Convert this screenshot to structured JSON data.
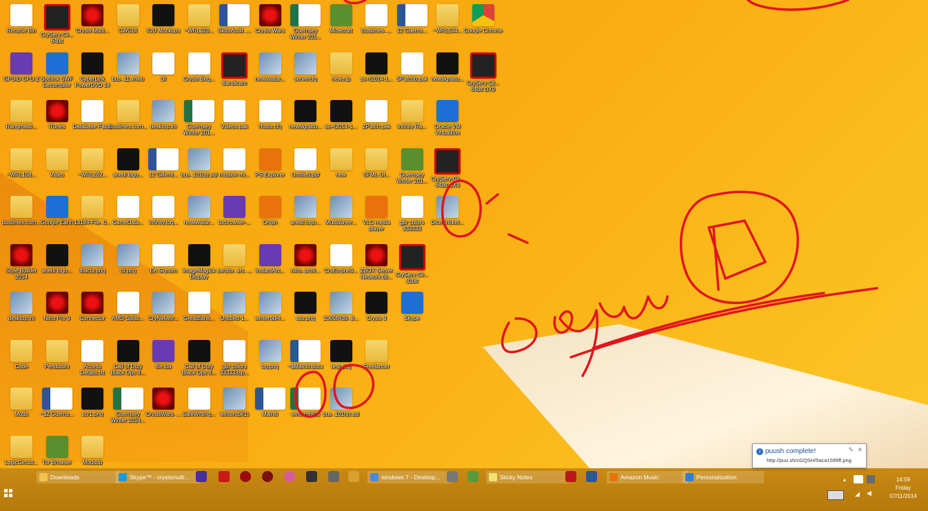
{
  "desktop": {
    "icons": [
      {
        "label": "Recycle Bin",
        "kind": "file"
      },
      {
        "label": "CryServ-Cli... 64bit",
        "kind": "red"
      },
      {
        "label": "Crysis Multi...",
        "kind": "crysis"
      },
      {
        "label": "CWGUI",
        "kind": "folder"
      },
      {
        "label": "IOU Mockups",
        "kind": "dark"
      },
      {
        "label": "~WRL323...",
        "kind": "folder"
      },
      {
        "label": "SkillsAudit_...",
        "kind": "word"
      },
      {
        "label": "Crysis Wars",
        "kind": "crysis"
      },
      {
        "label": "Guernsey Winter 201...",
        "kind": "excel"
      },
      {
        "label": "Minecraft",
        "kind": "green"
      },
      {
        "label": "Bustimes_...",
        "kind": "file"
      },
      {
        "label": "12 Guerns...",
        "kind": "word"
      },
      {
        "label": "~WRL534...",
        "kind": "folder"
      },
      {
        "label": "Google Chrome",
        "kind": "chrome"
      },
      {
        "label": "GPUID CPU-Z",
        "kind": "purple"
      },
      {
        "label": "Sothink SWF Decompiler",
        "kind": "blue"
      },
      {
        "label": "CyberLink PowerDVD 14",
        "kind": "dark"
      },
      {
        "label": "bus_11.xnwb",
        "kind": "img"
      },
      {
        "label": "UI",
        "kind": "file"
      },
      {
        "label": "Crysis Beg...",
        "kind": "file"
      },
      {
        "label": "Bandicam",
        "kind": "red"
      },
      {
        "label": "newavatar...",
        "kind": "img"
      },
      {
        "label": "servercfg",
        "kind": "img"
      },
      {
        "label": "news.jp",
        "kind": "folder"
      },
      {
        "label": "ss+(2014-1...",
        "kind": "dark"
      },
      {
        "label": "SPatchb.pak",
        "kind": "file"
      },
      {
        "label": "newsignatu...",
        "kind": "dark"
      },
      {
        "label": "CryServ-Cli... 64bit DX9",
        "kind": "red"
      },
      {
        "label": "Rangmasti...",
        "kind": "folder"
      },
      {
        "label": "iTunes",
        "kind": "crysis"
      },
      {
        "label": "Database Patch",
        "kind": "file"
      },
      {
        "label": "Bustimes.com...",
        "kind": "folder"
      },
      {
        "label": "desktop.ini",
        "kind": "img"
      },
      {
        "label": "Guernsey Winter 201...",
        "kind": "excel"
      },
      {
        "label": "Videos.pak",
        "kind": "file"
      },
      {
        "label": "Hosts.cfg",
        "kind": "file"
      },
      {
        "label": "newsignatu...",
        "kind": "dark"
      },
      {
        "label": "ss+(2014-1...",
        "kind": "dark"
      },
      {
        "label": "ZPatch.pak",
        "kind": "file"
      },
      {
        "label": "Infinity Ra...",
        "kind": "folder"
      },
      {
        "label": "Oracle VM VirtualBox",
        "kind": "blue"
      },
      {
        "label": "~WRL108...",
        "kind": "folder"
      },
      {
        "label": "Video",
        "kind": "folder"
      },
      {
        "label": "~WRL262...",
        "kind": "folder"
      },
      {
        "label": "anedi logo...",
        "kind": "dark"
      },
      {
        "label": "12 Gillenti...",
        "kind": "word"
      },
      {
        "label": "bus_101(s).sql",
        "kind": "img"
      },
      {
        "label": "mission mi...",
        "kind": "file"
      },
      {
        "label": "PS Explorer",
        "kind": "orange"
      },
      {
        "label": "Untitled.pdf",
        "kind": "file"
      },
      {
        "label": "new",
        "kind": "folder"
      },
      {
        "label": "SFML-UI...",
        "kind": "folder"
      },
      {
        "label": "Guernsey Winter 201...",
        "kind": "green"
      },
      {
        "label": "CryServ-Cli... 64bit DX9",
        "kind": "red"
      },
      {
        "label": "bustimes.com...",
        "kind": "folder"
      },
      {
        "label": "Google Earth",
        "kind": "blue"
      },
      {
        "label": "13184-File_0...",
        "kind": "folder"
      },
      {
        "label": "GameData...",
        "kind": "file"
      },
      {
        "label": "Infinity.log...",
        "kind": "file"
      },
      {
        "label": "newavatar...",
        "kind": "img"
      },
      {
        "label": "torbrowser-...",
        "kind": "purple"
      },
      {
        "label": "Origin",
        "kind": "orange"
      },
      {
        "label": "anedi.logo...",
        "kind": "img"
      },
      {
        "label": "Multiplayer...",
        "kind": "img"
      },
      {
        "label": "VLC media player",
        "kind": "orange"
      },
      {
        "label": "gbr colors 333333",
        "kind": "file"
      },
      {
        "label": "DiceCricket...",
        "kind": "img"
      },
      {
        "label": "Style Builder 2014",
        "kind": "crysis"
      },
      {
        "label": "anedi logo...",
        "kind": "dark"
      },
      {
        "label": "Ibacta.png",
        "kind": "img"
      },
      {
        "label": "cli.png",
        "kind": "img"
      },
      {
        "label": "EA Signum",
        "kind": "file"
      },
      {
        "label": "ImageMagick Display",
        "kind": "dark"
      },
      {
        "label": "ssrotor_src_...",
        "kind": "folder"
      },
      {
        "label": "InstantAct...",
        "kind": "purple"
      },
      {
        "label": "nitro_pro9...",
        "kind": "crysis"
      },
      {
        "label": "CryEngine3...",
        "kind": "file"
      },
      {
        "label": "ZBOX Server Network (B...",
        "kind": "crysis"
      },
      {
        "label": "CryServ-Cli... 32bit",
        "kind": "red"
      },
      {
        "label": "desktop.ini",
        "kind": "img"
      },
      {
        "label": "Nitro Pro 9",
        "kind": "crysis"
      },
      {
        "label": "Connector",
        "kind": "crysis"
      },
      {
        "label": "AMD Splas...",
        "kind": "file"
      },
      {
        "label": "CryNetwor...",
        "kind": "img"
      },
      {
        "label": "GreatBank...",
        "kind": "file"
      },
      {
        "label": "Untitled-1...",
        "kind": "img"
      },
      {
        "label": "winterobi4...",
        "kind": "img"
      },
      {
        "label": "sss.png",
        "kind": "dark"
      },
      {
        "label": "10658439_8...",
        "kind": "img"
      },
      {
        "label": "Crysis 3",
        "kind": "dark"
      },
      {
        "label": "Skype",
        "kind": "blue"
      },
      {
        "label": "Code",
        "kind": "folder"
      },
      {
        "label": "Pendulum",
        "kind": "folder"
      },
      {
        "label": "Access Details.txt",
        "kind": "file"
      },
      {
        "label": "Call of Duty Black Ops II...",
        "kind": "dark"
      },
      {
        "label": "file.lua",
        "kind": "purple"
      },
      {
        "label": "Call of Duty Black Ops II...",
        "kind": "dark"
      },
      {
        "label": "gbr colors 333333sp...",
        "kind": "file"
      },
      {
        "label": "bg.png",
        "kind": "img"
      },
      {
        "label": "~$Mainiti.docx",
        "kind": "word"
      },
      {
        "label": "test.png",
        "kind": "dark"
      },
      {
        "label": "Freelancer",
        "kind": "folder"
      },
      {
        "label": "Mods",
        "kind": "folder"
      },
      {
        "label": "~$2 Guerns...",
        "kind": "word"
      },
      {
        "label": "scr1.png",
        "kind": "dark"
      },
      {
        "label": "Guernsey Winter 2014...",
        "kind": "excel"
      },
      {
        "label": "CrysisWars_...",
        "kind": "crysis"
      },
      {
        "label": "SaleWriting...",
        "kind": "file"
      },
      {
        "label": "winterobi(1)",
        "kind": "img"
      },
      {
        "label": "Mainiti",
        "kind": "word"
      },
      {
        "label": "winterobi(1)",
        "kind": "excel"
      },
      {
        "label": "bus_101(s).sql",
        "kind": "img"
      },
      {
        "label": "LogicCircuit...",
        "kind": "folder"
      },
      {
        "label": "Tor Browser",
        "kind": "green"
      },
      {
        "label": "Modsdp",
        "kind": "folder"
      }
    ]
  },
  "taskbar": {
    "buttons": [
      {
        "label": "Downloads",
        "color": "#f3c24a"
      },
      {
        "label": "Skype™ - crysismulti...",
        "color": "#1e9ad6"
      },
      {
        "label": "windows 7 - Desktop...",
        "color": "#4a8ad6"
      },
      {
        "label": "Sticky Notes",
        "color": "#f5e070"
      },
      {
        "label": "Amazon Music",
        "color": "#e8730a"
      },
      {
        "label": "Personalization",
        "color": "#2f7fd6"
      }
    ],
    "clock": {
      "time": "14:59",
      "day": "Friday",
      "date": "07/11/2014"
    }
  },
  "notification": {
    "title": "puush complete!",
    "url": "http://puu.sh/cGQSH/5aca1599ff.png"
  },
  "annotation_color": "#e0151d"
}
